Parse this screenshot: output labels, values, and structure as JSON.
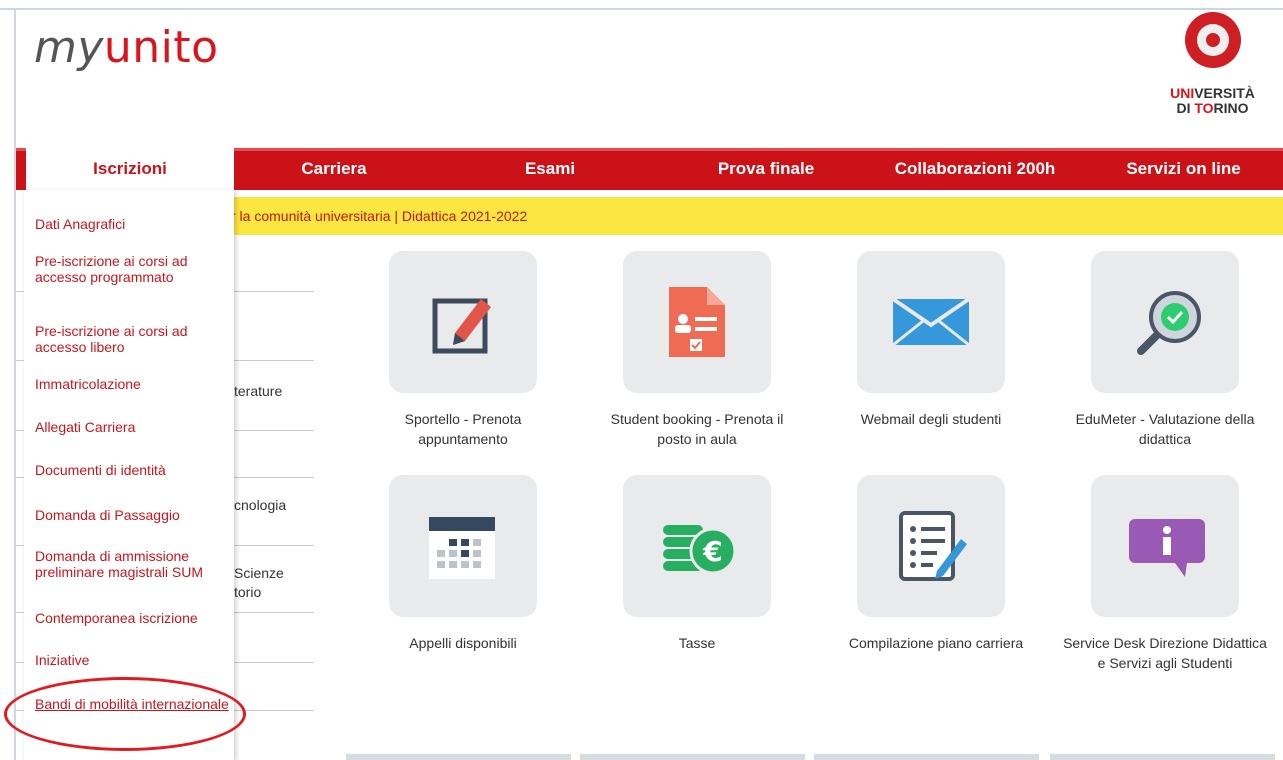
{
  "logo": {
    "my": "my",
    "unito": "unito"
  },
  "university": {
    "line1_red": "UNI",
    "line1": "VERSITÀ",
    "line2_a": "DI ",
    "line2_red": "TO",
    "line2_b": "RINO"
  },
  "nav": {
    "items": [
      {
        "label": "Iscrizioni"
      },
      {
        "label": "Carriera"
      },
      {
        "label": "Esami"
      },
      {
        "label": "Prova finale"
      },
      {
        "label": "Collaborazioni 200h"
      },
      {
        "label": "Servizi on line"
      }
    ]
  },
  "banner": {
    "text": "r la comunità universitaria | Didattica 2021-2022"
  },
  "dropdown": {
    "items": [
      {
        "label": "Dati Anagrafici"
      },
      {
        "label": "Pre-iscrizione ai corsi ad accesso programmato"
      },
      {
        "label": "Pre-iscrizione ai corsi ad accesso libero"
      },
      {
        "label": "Immatricolazione"
      },
      {
        "label": "Allegati Carriera"
      },
      {
        "label": "Documenti di identità"
      },
      {
        "label": "Domanda di Passaggio"
      },
      {
        "label": "Domanda di ammissione preliminare magistrali SUM"
      },
      {
        "label": "Contemporanea iscrizione"
      },
      {
        "label": "Iniziative"
      },
      {
        "label": "Bandi di mobilità internazionale"
      }
    ]
  },
  "background_fragments": {
    "t1": "terature",
    "t2": "cnologia",
    "t3": "Scienze",
    "t4": "torio"
  },
  "tiles": [
    {
      "label": "Sportello - Prenota appuntamento",
      "icon": "edit-icon"
    },
    {
      "label": "Student booking - Prenota il posto in aula",
      "icon": "booking-document-icon"
    },
    {
      "label": "Webmail degli studenti",
      "icon": "envelope-icon"
    },
    {
      "label": "EduMeter - Valutazione della didattica",
      "icon": "magnifier-check-icon"
    },
    {
      "label": "Appelli disponibili",
      "icon": "calendar-icon"
    },
    {
      "label": "Tasse",
      "icon": "euro-coins-icon"
    },
    {
      "label": "Compilazione piano carriera",
      "icon": "checklist-icon"
    },
    {
      "label": "Service Desk Direzione Didattica e Servizi agli Studenti",
      "icon": "info-chat-icon"
    }
  ],
  "colors": {
    "brand_red": "#cc1219",
    "banner_yellow": "#fce740",
    "tile_gray": "#e9eaec"
  }
}
